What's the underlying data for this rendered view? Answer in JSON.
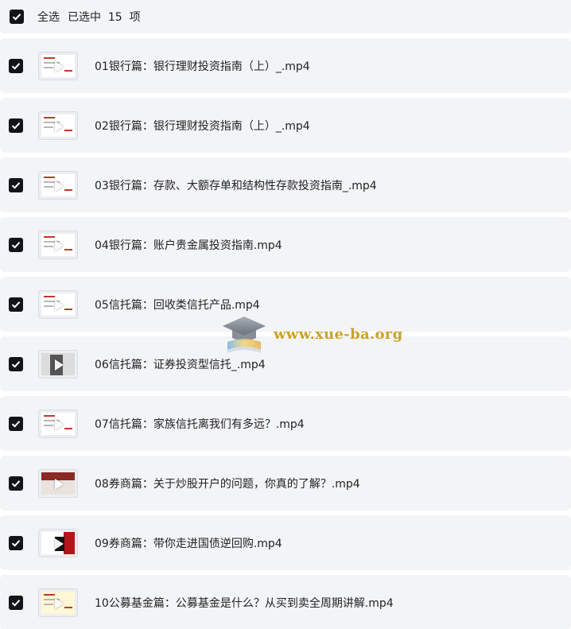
{
  "header": {
    "select_all_label": "全选",
    "selected_text": "已选中  15  项"
  },
  "files": [
    {
      "name": "01银行篇：银行理财投资指南（上）_.mp4",
      "thumb": "light"
    },
    {
      "name": "02银行篇：银行理财投资指南（上）_.mp4",
      "thumb": "light"
    },
    {
      "name": "03银行篇：存款、大额存单和结构性存款投资指南_.mp4",
      "thumb": "light"
    },
    {
      "name": "04银行篇：账户贵金属投资指南.mp4",
      "thumb": "light"
    },
    {
      "name": "05信托篇：回收类信托产品.mp4",
      "thumb": "light"
    },
    {
      "name": "06信托篇：证券投资型信托_.mp4",
      "thumb": "gray"
    },
    {
      "name": "07信托篇：家族信托离我们有多远？.mp4",
      "thumb": "light"
    },
    {
      "name": "08券商篇：关于炒股开户的问题，你真的了解？.mp4",
      "thumb": "dark"
    },
    {
      "name": "09券商篇：带你走进国债逆回购.mp4",
      "thumb": "red"
    },
    {
      "name": "10公募基金篇：公募基金是什么？从买到卖全周期讲解.mp4",
      "thumb": "yellow"
    }
  ],
  "watermark": {
    "text": "www.xue-ba.org",
    "icon": "graduation-cap-icon"
  },
  "colors": {
    "row_bg": "#f3f4f6",
    "checkbox": "#111418",
    "watermark": "#c9a227"
  }
}
